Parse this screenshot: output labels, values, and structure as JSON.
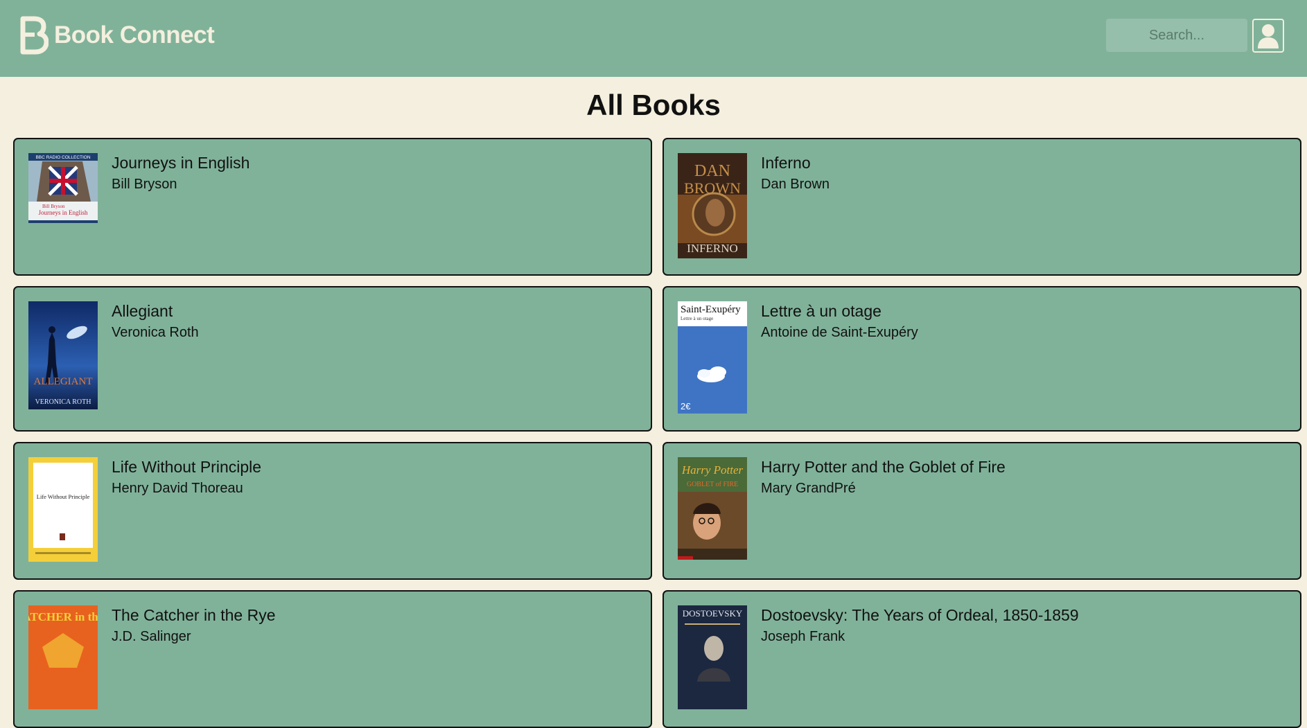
{
  "header": {
    "app_name": "Book Connect",
    "search_placeholder": "Search...",
    "colors": {
      "bar": "#80b29a",
      "brand_text": "#f4efde"
    },
    "icons": [
      "logo-b-icon",
      "user-icon"
    ]
  },
  "main": {
    "title": "All Books",
    "books": [
      {
        "title": "Journeys in English",
        "author": "Bill Bryson",
        "cover_text": [
          "BBC RADIO COLLECTION",
          "Bill Bryson",
          "Journeys in English"
        ]
      },
      {
        "title": "Inferno",
        "author": "Dan Brown",
        "cover_text": [
          "DAN",
          "BROWN",
          "INFERNO"
        ]
      },
      {
        "title": "Allegiant",
        "author": "Veronica Roth",
        "cover_text": [
          "ALLEGIANT",
          "VERONICA ROTH"
        ]
      },
      {
        "title": "Lettre à un otage",
        "author": "Antoine de Saint-Exupéry",
        "cover_text": [
          "Saint-Exupéry",
          "Lettre à un otage",
          "2€"
        ]
      },
      {
        "title": "Life Without Principle",
        "author": "Henry David Thoreau",
        "cover_text": [
          "Life Without Principle"
        ]
      },
      {
        "title": "Harry Potter and the Goblet of Fire",
        "author": "Mary GrandPré",
        "cover_text": [
          "Harry Potter",
          "GOBLET of FIRE"
        ]
      },
      {
        "title": "The Catcher in the Rye",
        "author": "J.D. Salinger",
        "cover_text": [
          "the CATCHER in the RYE"
        ]
      },
      {
        "title": "Dostoevsky: The Years of Ordeal, 1850-1859",
        "author": "Joseph Frank",
        "cover_text": [
          "DOSTOEVSKY"
        ]
      }
    ]
  }
}
